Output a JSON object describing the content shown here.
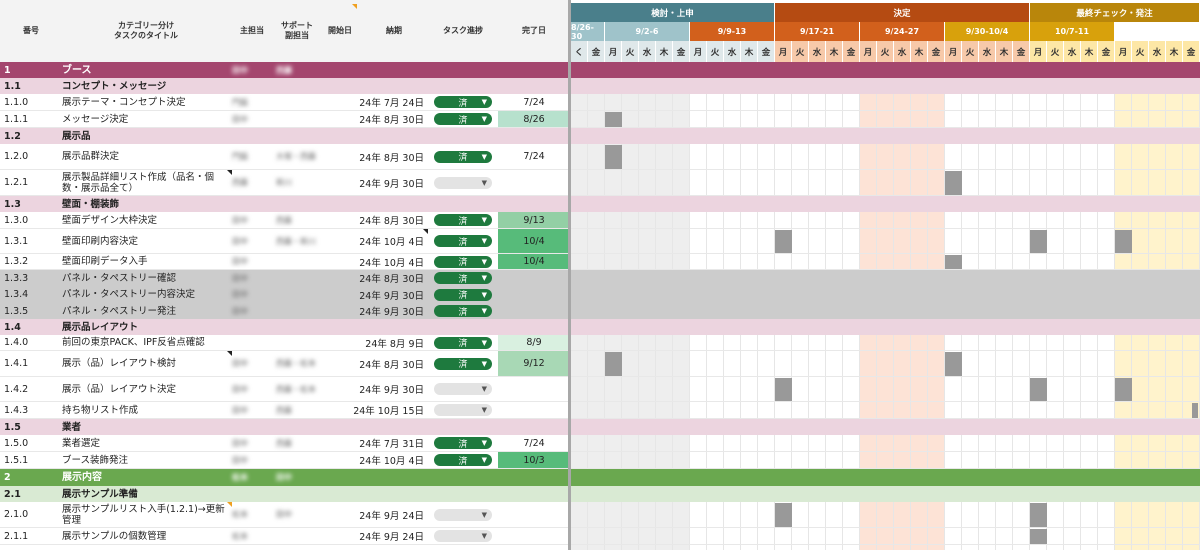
{
  "header": {
    "num": "番号",
    "title_line1": "カテゴリー分け",
    "title_line2": "タスクのタイトル",
    "main": "主担当",
    "sub_line1": "サポート",
    "sub_line2": "副担当",
    "start": "開始日",
    "due": "納期",
    "status": "タスク進捗",
    "done": "完了日"
  },
  "gantt": {
    "phases": [
      {
        "label": "検討・上申",
        "color": "#4a7f8b"
      },
      {
        "label": "決定",
        "color": "#b54b12"
      },
      {
        "label": "最終チェック・発注",
        "color": "#b9860b"
      }
    ],
    "weeks": [
      {
        "label": "8/26-30",
        "bg": "#9fc3ca",
        "fg": "#ffffff"
      },
      {
        "label": "9/2-6",
        "bg": "#9fc3ca",
        "fg": "#ffffff"
      },
      {
        "label": "9/9-13",
        "bg": "#d2601c",
        "fg": "#ffffff"
      },
      {
        "label": "9/17-21",
        "bg": "#d2601c",
        "fg": "#ffffff"
      },
      {
        "label": "9/24-27",
        "bg": "#d2601c",
        "fg": "#ffffff"
      },
      {
        "label": "9/30-10/4",
        "bg": "#d8a10c",
        "fg": "#ffffff"
      },
      {
        "label": "10/7-11",
        "bg": "#d8a10c",
        "fg": "#ffffff"
      }
    ],
    "day_names": [
      "月",
      "火",
      "水",
      "木",
      "金"
    ],
    "lead_day": "く",
    "lead_day2": "金"
  },
  "rows": [
    {
      "num": "1",
      "title": "ブース",
      "type": "l1",
      "main": "田中",
      "sub": "西藤"
    },
    {
      "num": "1.1",
      "title": "コンセプト・メッセージ",
      "type": "l2"
    },
    {
      "num": "1.1.0",
      "title": "展示テーマ・コンセプト決定",
      "type": "task",
      "main": "門脇",
      "due": "24年 7月 24日",
      "status": "済",
      "done": "7/24",
      "done_bg": ""
    },
    {
      "num": "1.1.1",
      "title": "メッセージ決定",
      "type": "task",
      "main": "田中",
      "due": "24年 8月 30日",
      "status": "済",
      "done": "8/26",
      "done_bg": "#b7e1cd"
    },
    {
      "num": "1.2",
      "title": "展示品",
      "type": "l2"
    },
    {
      "num": "1.2.0",
      "title": "展示品群決定",
      "type": "task",
      "main": "門脇",
      "sub": "大塚・西藤",
      "due": "24年 8月 30日",
      "status": "済",
      "done": "7/24",
      "done_bg": ""
    },
    {
      "num": "1.2.1",
      "title": "展示製品詳細リスト作成（品名・個数・展示品全て）",
      "type": "task",
      "main": "西藤",
      "sub": "新川",
      "due": "24年 9月 30日",
      "status": "",
      "done": "",
      "done_bg": ""
    },
    {
      "num": "1.3",
      "title": "壁面・棚装飾",
      "type": "l2"
    },
    {
      "num": "1.3.0",
      "title": "壁面デザイン大枠決定",
      "type": "task",
      "main": "田中",
      "sub": "西藤",
      "due": "24年 8月 30日",
      "status": "済",
      "done": "9/13",
      "done_bg": "#93cfa5"
    },
    {
      "num": "1.3.1",
      "title": "壁面印刷内容決定",
      "type": "task",
      "main": "田中",
      "sub": "西藤・新川",
      "due": "24年 10月 4日",
      "status": "済",
      "done": "10/4",
      "done_bg": "#57bb7a"
    },
    {
      "num": "1.3.2",
      "title": "壁面印刷データ入手",
      "type": "task",
      "main": "田中",
      "due": "24年 10月 4日",
      "status": "済",
      "done": "10/4",
      "done_bg": "#57bb7a"
    },
    {
      "num": "1.3.3",
      "title": "パネル・タペストリー確認",
      "type": "gray",
      "main": "田中",
      "due": "24年 8月 30日",
      "status": "済"
    },
    {
      "num": "1.3.4",
      "title": "パネル・タペストリー内容決定",
      "type": "gray",
      "main": "田中",
      "due": "24年 9月 30日",
      "status": "済"
    },
    {
      "num": "1.3.5",
      "title": "パネル・タペストリー発注",
      "type": "gray",
      "main": "田中",
      "due": "24年 9月 30日",
      "status": "済"
    },
    {
      "num": "1.4",
      "title": "展示品レイアウト",
      "type": "l2"
    },
    {
      "num": "1.4.0",
      "title": "前回の東京PACK、IPF反省点確認",
      "type": "task",
      "main": "",
      "due": "24年 8月 9日",
      "status": "済",
      "done": "8/9",
      "done_bg": "#d9f0e0"
    },
    {
      "num": "1.4.1",
      "title": "展示（品）レイアウト検討",
      "type": "task",
      "main": "田中",
      "sub": "西藤・松本",
      "due": "24年 8月 30日",
      "status": "済",
      "done": "9/12",
      "done_bg": "#a8d8b5"
    },
    {
      "num": "1.4.2",
      "title": "展示（品）レイアウト決定",
      "type": "task",
      "main": "田中",
      "sub": "西藤・松本",
      "due": "24年 9月 30日",
      "status": "",
      "done": "",
      "done_bg": ""
    },
    {
      "num": "1.4.3",
      "title": "持ち物リスト作成",
      "type": "task",
      "main": "田中",
      "sub": "西藤",
      "due": "24年 10月 15日",
      "status": "",
      "done": "",
      "done_bg": ""
    },
    {
      "num": "1.5",
      "title": "業者",
      "type": "l2"
    },
    {
      "num": "1.5.0",
      "title": "業者選定",
      "type": "task",
      "main": "田中",
      "sub": "西藤",
      "due": "24年 7月 31日",
      "status": "済",
      "done": "7/24",
      "done_bg": ""
    },
    {
      "num": "1.5.1",
      "title": "ブース装飾発注",
      "type": "task",
      "main": "田中",
      "due": "24年 10月 4日",
      "status": "済",
      "done": "10/3",
      "done_bg": "#57bb7a"
    },
    {
      "num": "2",
      "title": "展示内容",
      "type": "l1g",
      "main": "松本",
      "sub": "田中"
    },
    {
      "num": "2.1",
      "title": "展示サンプル準備",
      "type": "l2g"
    },
    {
      "num": "2.1.0",
      "title": "展示サンプルリスト入手(1.2.1)→更新管理",
      "type": "task",
      "main": "松本",
      "sub": "田中",
      "due": "24年 9月 24日",
      "status": "",
      "done": "",
      "done_bg": ""
    },
    {
      "num": "2.1.1",
      "title": "展示サンプルの個数管理",
      "type": "task",
      "main": "松本",
      "due": "24年 9月 24日",
      "status": "",
      "done": "",
      "done_bg": ""
    }
  ],
  "colors": {
    "l1": "#a4466e",
    "l2": "#ecd4df",
    "l1g": "#6aa84f",
    "l2g": "#d9ead3",
    "gray": "#cccccc"
  }
}
